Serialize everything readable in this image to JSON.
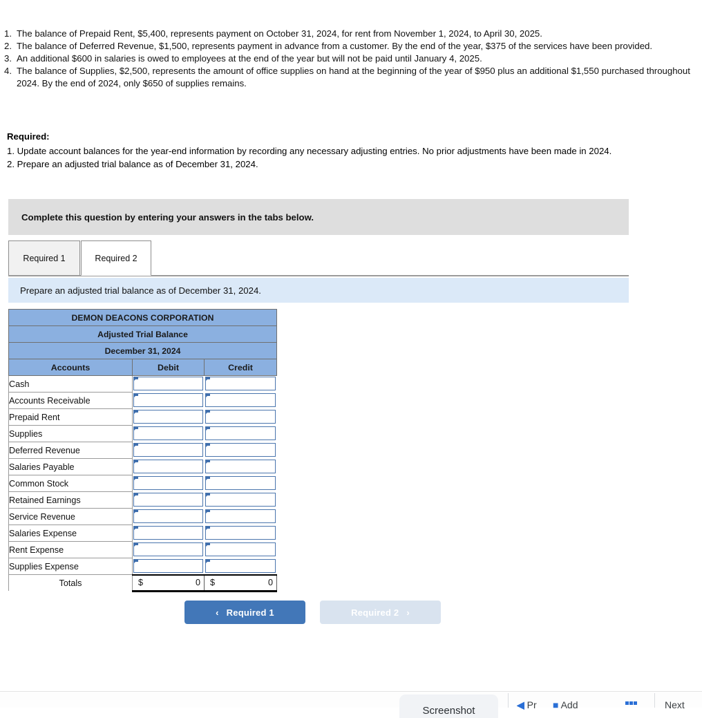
{
  "facts": [
    {
      "num": "1.",
      "text": "The balance of Prepaid Rent, $5,400, represents payment on October 31, 2024, for rent from November 1, 2024, to April 30, 2025."
    },
    {
      "num": "2.",
      "text": "The balance of  Deferred Revenue, $1,500, represents payment in advance from a customer. By the end of the year, $375 of the services have been provided."
    },
    {
      "num": "3.",
      "text": "An additional $600 in salaries is owed to employees at the end of the year but will not be paid until January 4, 2025."
    },
    {
      "num": "4.",
      "text": "The balance of Supplies, $2,500, represents the amount of office supplies on hand at the beginning of the year of $950 plus an additional $1,550 purchased throughout 2024. By the end of 2024, only $650 of supplies remains."
    }
  ],
  "required": {
    "title": "Required:",
    "line1": "1. Update account balances for the year-end information by recording any necessary adjusting entries. No prior adjustments have been made in 2024.",
    "line2": "2. Prepare an adjusted trial balance as of December 31, 2024."
  },
  "banner": {
    "text": "Complete this question by entering your answers in the tabs below."
  },
  "tabs": [
    {
      "label": "Required 1",
      "active": false
    },
    {
      "label": "Required 2",
      "active": true
    }
  ],
  "sub_instruction": {
    "text": "Prepare an adjusted trial balance as of December 31, 2024."
  },
  "trial_balance": {
    "company": "DEMON DEACONS CORPORATION",
    "statement": "Adjusted Trial Balance",
    "date": "December 31, 2024",
    "columns": [
      "Accounts",
      "Debit",
      "Credit"
    ],
    "rows": [
      {
        "account": "Cash",
        "debit": "",
        "credit": ""
      },
      {
        "account": "Accounts Receivable",
        "debit": "",
        "credit": ""
      },
      {
        "account": "Prepaid Rent",
        "debit": "",
        "credit": ""
      },
      {
        "account": "Supplies",
        "debit": "",
        "credit": ""
      },
      {
        "account": "Deferred Revenue",
        "debit": "",
        "credit": ""
      },
      {
        "account": "Salaries Payable",
        "debit": "",
        "credit": ""
      },
      {
        "account": "Common Stock",
        "debit": "",
        "credit": ""
      },
      {
        "account": "Retained Earnings",
        "debit": "",
        "credit": ""
      },
      {
        "account": "Service Revenue",
        "debit": "",
        "credit": ""
      },
      {
        "account": "Salaries Expense",
        "debit": "",
        "credit": ""
      },
      {
        "account": "Rent Expense",
        "debit": "",
        "credit": ""
      },
      {
        "account": "Supplies Expense",
        "debit": "",
        "credit": ""
      }
    ],
    "totals": {
      "label": "Totals",
      "debit_symbol": "$",
      "debit_value": "0",
      "credit_symbol": "$",
      "credit_value": "0"
    }
  },
  "nav": {
    "prev_label": "Required 1",
    "prev_chevron": "‹",
    "next_label": "Required 2",
    "next_chevron": "›"
  },
  "bottom_bar": {
    "screenshot_label": "Screenshot",
    "partial_1": "Pr",
    "partial_2": "Add",
    "partial_3": "Next"
  },
  "colors": {
    "banner_gray": "#dedede",
    "instruction_blue": "#dbe9f8",
    "table_header_blue": "#8bb0e0",
    "input_border_blue": "#4a75ad",
    "primary_button": "#4277b8",
    "disabled_button": "#d9e3ef"
  }
}
